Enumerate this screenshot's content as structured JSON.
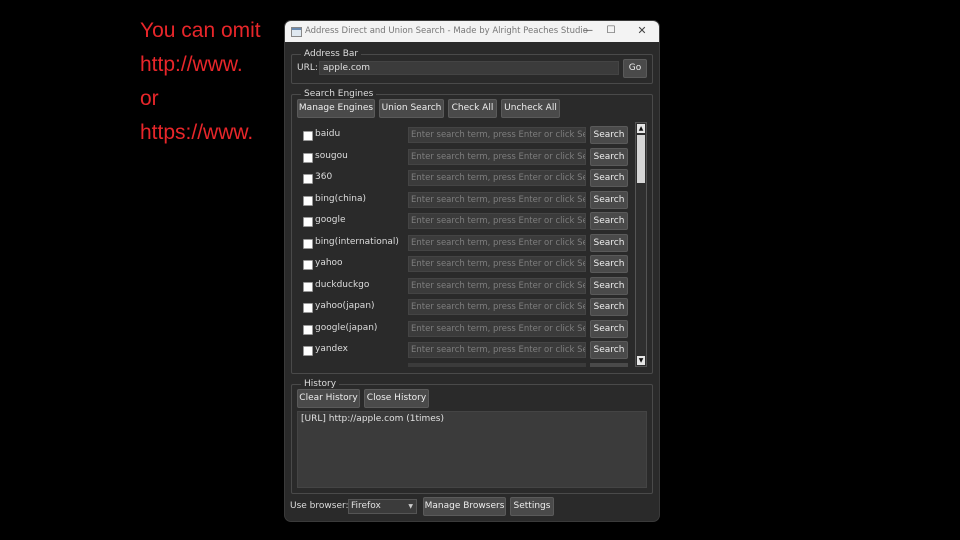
{
  "caption": {
    "lines": [
      "You can omit",
      "http://www.",
      "or",
      "https://www."
    ],
    "color": "#e8262a"
  },
  "window": {
    "title": "Address Direct and Union Search - Made by Alright Peaches Studio",
    "controls": {
      "minimize": "—",
      "maximize": "☐",
      "close": "✕"
    }
  },
  "address_bar": {
    "group_title": "Address Bar",
    "url_label": "URL:",
    "url_value": "apple.com",
    "go_label": "Go"
  },
  "search_engines": {
    "group_title": "Search Engines",
    "buttons": {
      "manage": "Manage Engines",
      "union": "Union Search",
      "check_all": "Check All",
      "uncheck_all": "Uncheck All"
    },
    "placeholder": "Enter search term, press Enter or click Se...",
    "search_label": "Search",
    "engines": [
      "baidu",
      "sougou",
      "360",
      "bing(china)",
      "google",
      "bing(international)",
      "yahoo",
      "duckduckgo",
      "yahoo(japan)",
      "google(japan)",
      "yandex"
    ]
  },
  "history": {
    "group_title": "History",
    "clear_label": "Clear History",
    "close_label": "Close History",
    "entries": [
      "[URL] http://apple.com  (1times)"
    ]
  },
  "footer": {
    "browser_label": "Use browser:",
    "browser_value": "Firefox",
    "manage_browsers": "Manage Browsers",
    "settings": "Settings"
  }
}
